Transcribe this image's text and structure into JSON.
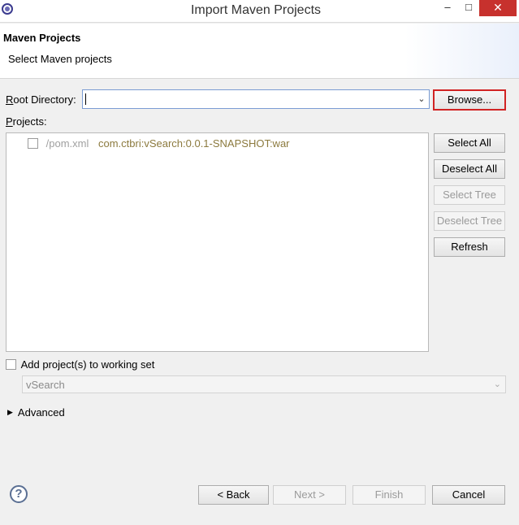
{
  "window": {
    "title": "Import Maven Projects",
    "minimize": "–",
    "maximize": "□",
    "close": "✕"
  },
  "header": {
    "title": "Maven Projects",
    "description": "Select Maven projects"
  },
  "root_directory": {
    "label_u": "R",
    "label_rest": "oot Directory:",
    "value": "",
    "browse_label": "Browse..."
  },
  "projects": {
    "label_u": "P",
    "label_rest": "rojects:",
    "items": [
      {
        "path": "/pom.xml",
        "artifact": "com.ctbri:vSearch:0.0.1-SNAPSHOT:war",
        "checked": false
      }
    ]
  },
  "side_buttons": {
    "select_all": "Select All",
    "deselect_all": "Deselect All",
    "select_tree": "Select Tree",
    "deselect_tree": "Deselect Tree",
    "refresh": "Refresh"
  },
  "working_set": {
    "checkbox_label": "Add project(s) to working set",
    "value": "vSearch"
  },
  "advanced": {
    "label": "Advanced"
  },
  "footer": {
    "help": "?",
    "back": "< Back",
    "next": "Next >",
    "finish": "Finish",
    "cancel": "Cancel"
  }
}
